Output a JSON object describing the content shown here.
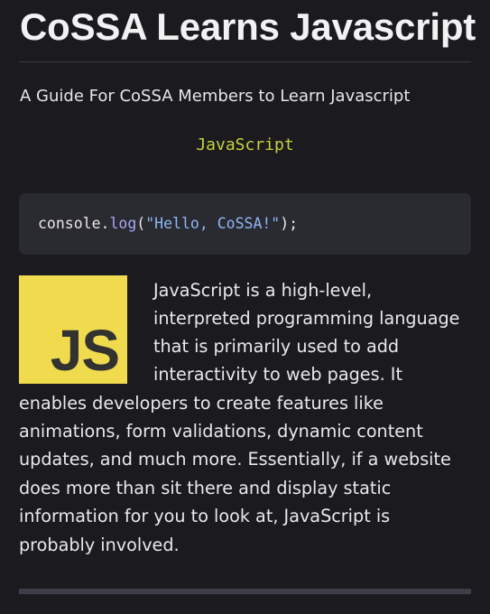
{
  "header": {
    "title": "CoSSA Learns Javascript",
    "subtitle": "A Guide For CoSSA Members to Learn Javascript"
  },
  "language_label": "JavaScript",
  "code": {
    "object": "console",
    "dot": ".",
    "method": "log",
    "open": "(",
    "string": "\"Hello, CoSSA!\"",
    "close": ");"
  },
  "logo": {
    "text": "JS",
    "background": "#f0db4f",
    "foreground": "#323330"
  },
  "description": {
    "lines": [
      "JavaScript is a high-level,",
      "interpreted programming language",
      "that is primarily used to add",
      "interactivity to web pages. It",
      "enables developers to create features like",
      "animations, form validations, dynamic content",
      "updates, and much more. Essentially, if a website",
      "does more than sit there and display static",
      "information for you to look at, JavaScript is",
      "probably involved."
    ]
  },
  "colors": {
    "background": "#1b1b1f",
    "code_background": "#2a2a31",
    "accent_label": "#c5d33a",
    "code_method": "#a6a8f5",
    "code_string": "#8fb6f2"
  }
}
